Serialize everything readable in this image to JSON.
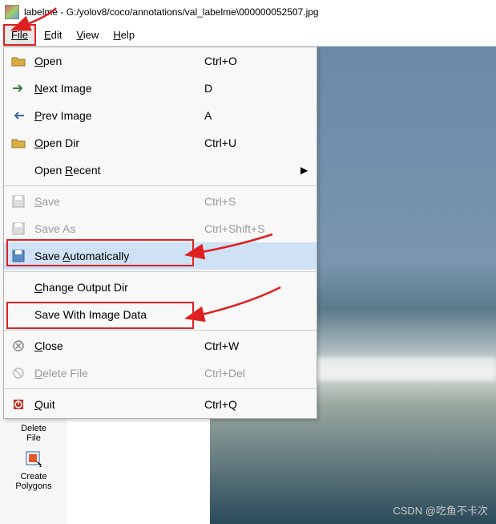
{
  "title": "labelme - G:/yolov8/coco/annotations/val_labelme\\000000052507.jpg",
  "menubar": {
    "file": "File",
    "edit": "Edit",
    "view": "View",
    "help": "Help"
  },
  "menu": {
    "open": {
      "label": "Open",
      "ul": "O",
      "shortcut": "Ctrl+O"
    },
    "next": {
      "label": "Next Image",
      "ul": "N",
      "shortcut": "D"
    },
    "prev": {
      "label": "Prev Image",
      "ul": "P",
      "shortcut": "A"
    },
    "opendir": {
      "label": "Open Dir",
      "ul": "O",
      "shortcut": "Ctrl+U"
    },
    "recent": {
      "label": "Open Recent",
      "ul": "R",
      "shortcut": ""
    },
    "save": {
      "label": "Save",
      "ul": "S",
      "shortcut": "Ctrl+S"
    },
    "saveas": {
      "label": "Save As",
      "ul": "",
      "shortcut": "Ctrl+Shift+S"
    },
    "saveauto": {
      "label": "Save Automatically",
      "ul": "A",
      "shortcut": ""
    },
    "changeout": {
      "label": "Change Output Dir",
      "ul": "C",
      "shortcut": ""
    },
    "withdata": {
      "label": "Save With Image Data",
      "ul": "",
      "shortcut": ""
    },
    "close": {
      "label": "Close",
      "ul": "C",
      "shortcut": "Ctrl+W"
    },
    "deletefile": {
      "label": "Delete File",
      "ul": "D",
      "shortcut": "Ctrl+Del"
    },
    "quit": {
      "label": "Quit",
      "ul": "Q",
      "shortcut": "Ctrl+Q"
    }
  },
  "tools": {
    "delete": "Delete\nFile",
    "create": "Create\nPolygons"
  },
  "watermark": "CSDN @吃鱼不卡次"
}
